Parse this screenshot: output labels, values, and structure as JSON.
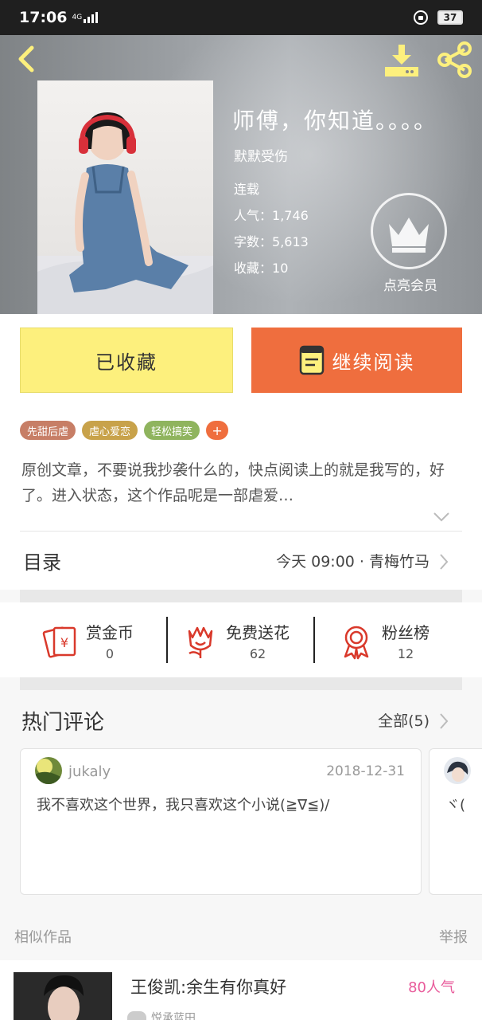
{
  "status_bar": {
    "time": "17:06",
    "network": "4G",
    "battery": "37"
  },
  "book": {
    "title": "师傅，你知道。。。。",
    "author": "默默受伤",
    "status": "连载",
    "popularity_label": "人气：",
    "popularity": "1,746",
    "words_label": "字数：",
    "words": "5,613",
    "favorites_label": "收藏：",
    "favorites": "10",
    "vip_label": "点亮会员"
  },
  "actions": {
    "favorited_label": "已收藏",
    "continue_label": "继续阅读"
  },
  "colors": {
    "fav_button": "#fdf07d",
    "read_button": "#ef6e3e",
    "accent": "#ef6e3e"
  },
  "tags": [
    {
      "label": "先甜后虐",
      "color": "#c77e66"
    },
    {
      "label": "虐心爱恋",
      "color": "#c8a24a"
    },
    {
      "label": "轻松搞笑",
      "color": "#8fb45e"
    }
  ],
  "tag_more": "+",
  "description": "原创文章，不要说我抄袭什么的，快点阅读上的就是我写的，好了。进入状态，这个作品呢是一部虐爱…",
  "toc": {
    "label": "目录",
    "latest": "今天 09:00 · 青梅竹马"
  },
  "stats": [
    {
      "label": "赏金币",
      "value": "0",
      "icon": "red-envelope-icon"
    },
    {
      "label": "免费送花",
      "value": "62",
      "icon": "flower-icon"
    },
    {
      "label": "粉丝榜",
      "value": "12",
      "icon": "medal-icon"
    }
  ],
  "comments": {
    "title": "热门评论",
    "all_label": "全部(5)",
    "items": [
      {
        "user": "jukaly",
        "date": "2018-12-31",
        "text": "我不喜欢这个世界，我只喜欢这个小说(≧∇≦)/"
      }
    ],
    "next_preview_text": "ヾ("
  },
  "similar": {
    "label": "相似作品",
    "report_label": "举报"
  },
  "recommendation": {
    "title": "王俊凯:余生有你真好",
    "popularity": "80人气",
    "sub": "悦承蓝田"
  }
}
